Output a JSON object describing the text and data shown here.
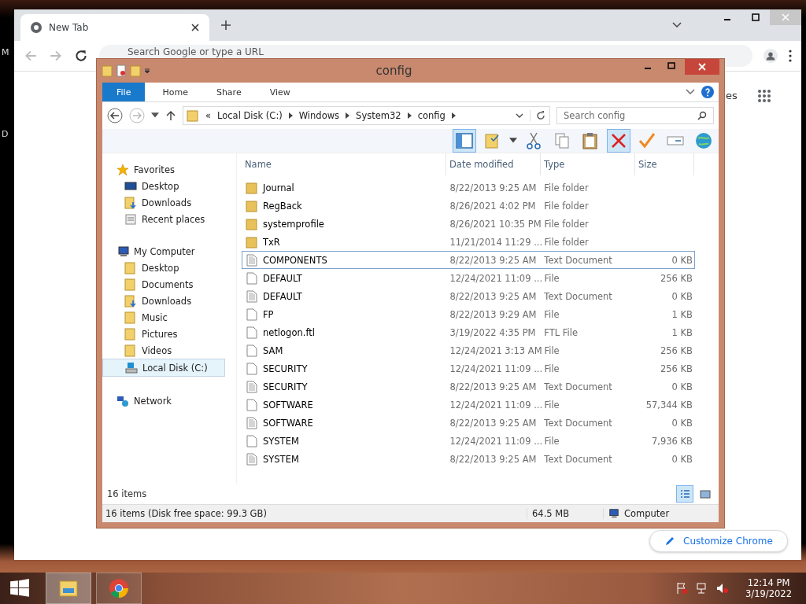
{
  "desktop": {
    "labels": [
      "M",
      "D"
    ]
  },
  "chrome": {
    "tab": {
      "title": "New Tab"
    },
    "address": {
      "placeholder": "Search Google or type a URL"
    },
    "images_link": "es",
    "customize_button": "Customize Chrome"
  },
  "explorer": {
    "title": "config",
    "ribbon_tabs": [
      {
        "label": "File",
        "kind": "file",
        "selected": false
      },
      {
        "label": "Home",
        "kind": "tab",
        "selected": false
      },
      {
        "label": "Share",
        "kind": "tab",
        "selected": false
      },
      {
        "label": "View",
        "kind": "tab",
        "selected": false
      }
    ],
    "breadcrumb": [
      "«",
      "Local Disk (C:)",
      "Windows",
      "System32",
      "config"
    ],
    "search": {
      "placeholder": "Search config"
    },
    "sidebar": [
      {
        "label": "Favorites",
        "kind": "star",
        "selected": false,
        "children": [
          {
            "label": "Desktop",
            "kind": "monitor",
            "selected": false
          },
          {
            "label": "Downloads",
            "kind": "download",
            "selected": false
          },
          {
            "label": "Recent places",
            "kind": "recent",
            "selected": false
          }
        ]
      },
      {
        "label": "My Computer",
        "kind": "computer",
        "selected": false,
        "children": [
          {
            "label": "Desktop",
            "kind": "folder",
            "selected": false
          },
          {
            "label": "Documents",
            "kind": "folder",
            "selected": false
          },
          {
            "label": "Downloads",
            "kind": "download",
            "selected": false
          },
          {
            "label": "Music",
            "kind": "folder",
            "selected": false
          },
          {
            "label": "Pictures",
            "kind": "folder",
            "selected": false
          },
          {
            "label": "Videos",
            "kind": "folder",
            "selected": false
          },
          {
            "label": "Local Disk (C:)",
            "kind": "drive",
            "selected": true
          }
        ]
      },
      {
        "label": "Network",
        "kind": "network",
        "selected": false
      }
    ],
    "columns": [
      "Name",
      "Date modified",
      "Type",
      "Size"
    ],
    "rows": [
      {
        "name": "Journal",
        "date": "8/22/2013 9:25 AM",
        "type": "File folder",
        "size": "",
        "kind": "folder",
        "focused": false
      },
      {
        "name": "RegBack",
        "date": "8/26/2021 4:02 PM",
        "type": "File folder",
        "size": "",
        "kind": "folder",
        "focused": false
      },
      {
        "name": "systemprofile",
        "date": "8/26/2021 10:35 PM",
        "type": "File folder",
        "size": "",
        "kind": "folder",
        "focused": false
      },
      {
        "name": "TxR",
        "date": "11/21/2014 11:29 ...",
        "type": "File folder",
        "size": "",
        "kind": "folder",
        "focused": false
      },
      {
        "name": "COMPONENTS",
        "date": "8/22/2013 9:25 AM",
        "type": "Text Document",
        "size": "0 KB",
        "kind": "text",
        "focused": true
      },
      {
        "name": "DEFAULT",
        "date": "12/24/2021 11:09 ...",
        "type": "File",
        "size": "256 KB",
        "kind": "file",
        "focused": false
      },
      {
        "name": "DEFAULT",
        "date": "8/22/2013 9:25 AM",
        "type": "Text Document",
        "size": "0 KB",
        "kind": "text",
        "focused": false
      },
      {
        "name": "FP",
        "date": "8/22/2013 9:29 AM",
        "type": "File",
        "size": "1 KB",
        "kind": "file",
        "focused": false
      },
      {
        "name": "netlogon.ftl",
        "date": "3/19/2022 4:35 PM",
        "type": "FTL File",
        "size": "1 KB",
        "kind": "file",
        "focused": false
      },
      {
        "name": "SAM",
        "date": "12/24/2021 3:13 AM",
        "type": "File",
        "size": "256 KB",
        "kind": "file",
        "focused": false
      },
      {
        "name": "SECURITY",
        "date": "12/24/2021 11:09 ...",
        "type": "File",
        "size": "256 KB",
        "kind": "file",
        "focused": false
      },
      {
        "name": "SECURITY",
        "date": "8/22/2013 9:25 AM",
        "type": "Text Document",
        "size": "0 KB",
        "kind": "text",
        "focused": false
      },
      {
        "name": "SOFTWARE",
        "date": "12/24/2021 11:09 ...",
        "type": "File",
        "size": "57,344 KB",
        "kind": "file",
        "focused": false
      },
      {
        "name": "SOFTWARE",
        "date": "8/22/2013 9:25 AM",
        "type": "Text Document",
        "size": "0 KB",
        "kind": "text",
        "focused": false
      },
      {
        "name": "SYSTEM",
        "date": "12/24/2021 11:09 ...",
        "type": "File",
        "size": "7,936 KB",
        "kind": "file",
        "focused": false
      },
      {
        "name": "SYSTEM",
        "date": "8/22/2013 9:25 AM",
        "type": "Text Document",
        "size": "0 KB",
        "kind": "text",
        "focused": false
      }
    ],
    "item_count": "16 items",
    "status_bar": {
      "summary": "16 items (Disk free space: 99.3 GB)",
      "size": "64.5 MB",
      "location": "Computer"
    }
  },
  "taskbar": {
    "time": "12:14 PM",
    "date": "3/19/2022"
  }
}
